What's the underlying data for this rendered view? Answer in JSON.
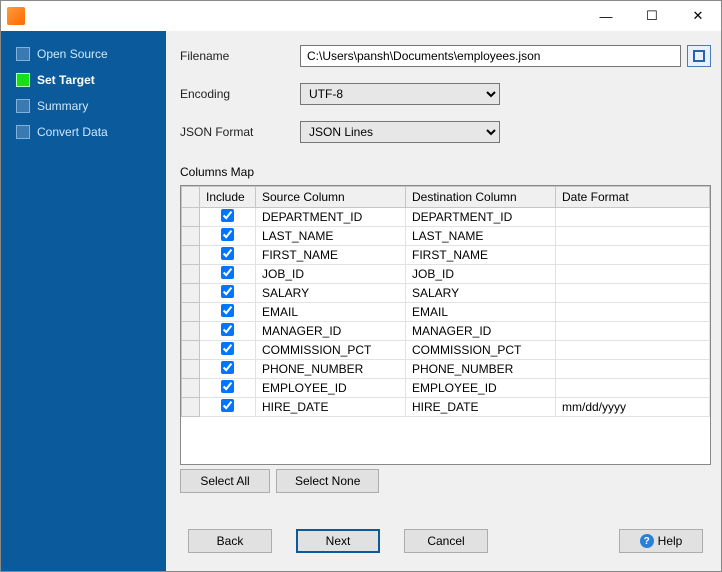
{
  "titlebar": {
    "minimize": "—",
    "maximize": "☐",
    "close": "✕"
  },
  "sidebar": {
    "items": [
      {
        "label": "Open Source",
        "active": false
      },
      {
        "label": "Set Target",
        "active": true
      },
      {
        "label": "Summary",
        "active": false
      },
      {
        "label": "Convert Data",
        "active": false
      }
    ]
  },
  "form": {
    "filename_label": "Filename",
    "filename_value": "C:\\Users\\pansh\\Documents\\employees.json",
    "encoding_label": "Encoding",
    "encoding_value": "UTF-8",
    "jsonformat_label": "JSON Format",
    "jsonformat_value": "JSON Lines"
  },
  "columns_map": {
    "title": "Columns Map",
    "headers": {
      "include": "Include",
      "source": "Source Column",
      "dest": "Destination Column",
      "datefmt": "Date Format"
    },
    "rows": [
      {
        "include": true,
        "source": "DEPARTMENT_ID",
        "dest": "DEPARTMENT_ID",
        "datefmt": ""
      },
      {
        "include": true,
        "source": "LAST_NAME",
        "dest": "LAST_NAME",
        "datefmt": ""
      },
      {
        "include": true,
        "source": "FIRST_NAME",
        "dest": "FIRST_NAME",
        "datefmt": ""
      },
      {
        "include": true,
        "source": "JOB_ID",
        "dest": "JOB_ID",
        "datefmt": ""
      },
      {
        "include": true,
        "source": "SALARY",
        "dest": "SALARY",
        "datefmt": ""
      },
      {
        "include": true,
        "source": "EMAIL",
        "dest": "EMAIL",
        "datefmt": ""
      },
      {
        "include": true,
        "source": "MANAGER_ID",
        "dest": "MANAGER_ID",
        "datefmt": ""
      },
      {
        "include": true,
        "source": "COMMISSION_PCT",
        "dest": "COMMISSION_PCT",
        "datefmt": ""
      },
      {
        "include": true,
        "source": "PHONE_NUMBER",
        "dest": "PHONE_NUMBER",
        "datefmt": ""
      },
      {
        "include": true,
        "source": "EMPLOYEE_ID",
        "dest": "EMPLOYEE_ID",
        "datefmt": ""
      },
      {
        "include": true,
        "source": "HIRE_DATE",
        "dest": "HIRE_DATE",
        "datefmt": "mm/dd/yyyy"
      }
    ],
    "select_all": "Select All",
    "select_none": "Select None"
  },
  "footer": {
    "back": "Back",
    "next": "Next",
    "cancel": "Cancel",
    "help": "Help"
  }
}
